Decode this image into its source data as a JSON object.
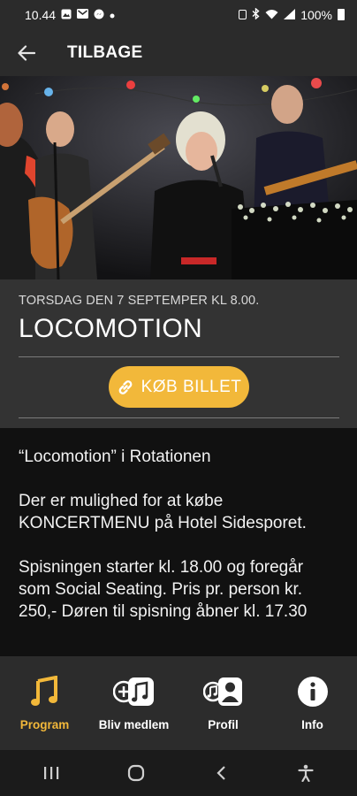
{
  "status_bar": {
    "time": "10.44",
    "battery": "100%",
    "icons_left": [
      "gallery-icon",
      "mail-icon",
      "messenger-icon",
      "dot-icon"
    ],
    "icons_right": [
      "sim-icon",
      "bluetooth-icon",
      "wifi-icon",
      "signal-icon",
      "battery-icon"
    ]
  },
  "header": {
    "back_label": "TILBAGE"
  },
  "event": {
    "date": "TORSDAG DEN 7 SEPTEMPER KL 8.00.",
    "title": "LOCOMOTION",
    "buy_label": "KØB BILLET"
  },
  "description": {
    "paragraphs": [
      "“Locomotion” i Rotationen",
      "Der er mulighed for at købe KONCERTMENU på Hotel Sidesporet.",
      "Spisningen starter kl. 18.00 og foregår som Social Seating. Pris pr. person kr. 250,- Døren til spisning åbner kl. 17.30"
    ]
  },
  "tabs": [
    {
      "label": "Program",
      "icon": "music-note-icon",
      "active": true
    },
    {
      "label": "Bliv medlem",
      "icon": "add-member-icon",
      "active": false
    },
    {
      "label": "Profil",
      "icon": "profile-icon",
      "active": false
    },
    {
      "label": "Info",
      "icon": "info-icon",
      "active": false
    }
  ],
  "colors": {
    "accent": "#f2b83a",
    "app_bar": "#2b2b2b",
    "event_panel": "#333333",
    "body_bg": "#111111"
  }
}
